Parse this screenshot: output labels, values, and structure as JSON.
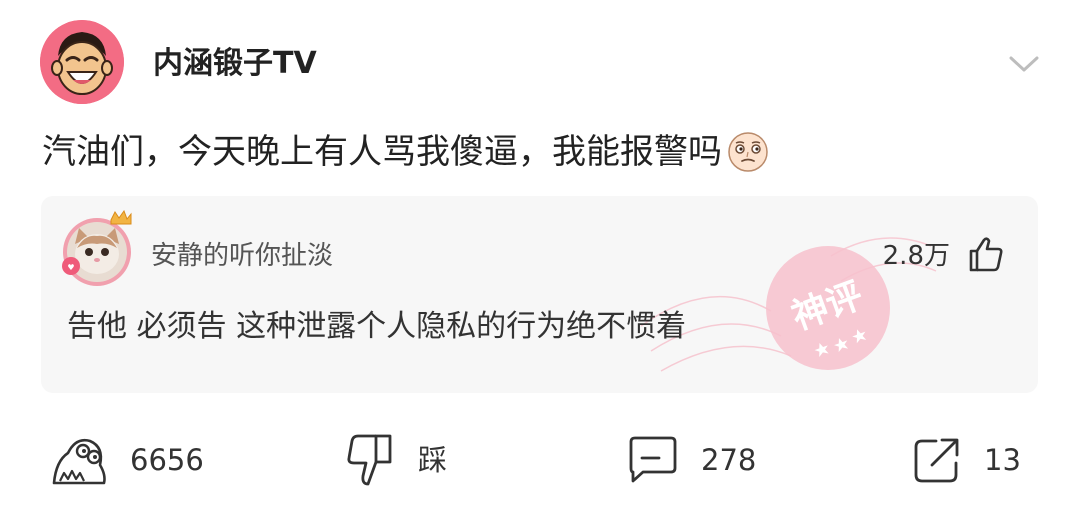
{
  "post": {
    "author": "内涵锻子TV",
    "text": "汽油们，今天晚上有人骂我傻逼，我能报警吗"
  },
  "top_comment": {
    "username": "安静的听你扯淡",
    "likes": "2.8万",
    "text": "告他  必须告  这种泄露个人隐私的行为绝不惯着",
    "stamp_text": "神评"
  },
  "actions": {
    "upvotes": "6656",
    "downvote_label": "踩",
    "comments": "278",
    "shares": "13"
  },
  "colors": {
    "avatar_bg": "#f36c84",
    "card_bg": "#f7f7f7",
    "stamp_pink": "#f4b6c2"
  },
  "icons": {
    "menu": "chevron-down-icon",
    "comment_like": "thumbs-up-icon",
    "upvote": "laughing-face-icon",
    "downvote": "thumbs-down-icon",
    "comment": "comment-bubble-icon",
    "share": "share-arrow-icon"
  }
}
